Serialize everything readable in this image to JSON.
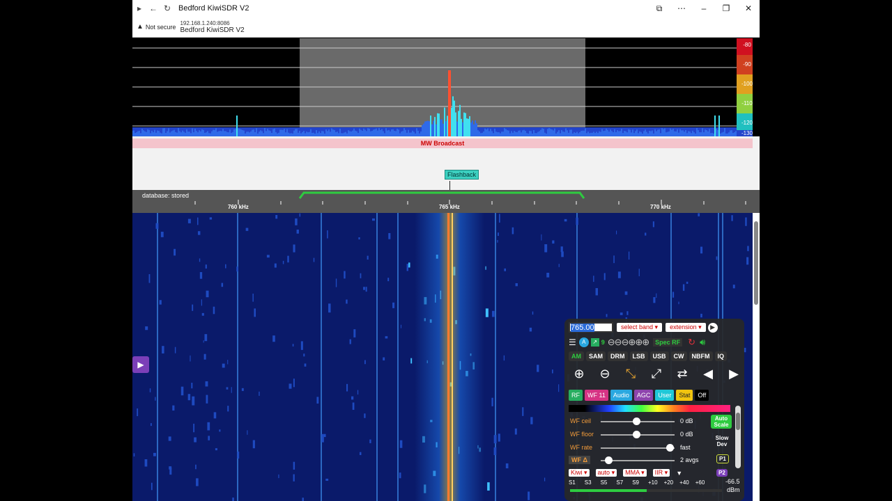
{
  "browser": {
    "title": "Bedford KiwiSDR V2",
    "security": "Not secure",
    "url": "192.168.1.240:8086",
    "page_title": "Bedford KiwiSDR V2"
  },
  "spectrum": {
    "db_labels": [
      "-80",
      "-90",
      "-100",
      "-110",
      "-120",
      "-130"
    ]
  },
  "band": {
    "label": "MW Broadcast",
    "station": "Flashback"
  },
  "scale": {
    "database": "database: stored",
    "freq_labels": [
      "760 kHz",
      "765 kHz",
      "770 kHz"
    ]
  },
  "panel": {
    "frequency": "765.00",
    "select_band": "select band",
    "extension": "extension",
    "badge_a": "A",
    "badge_9": "9",
    "spec_rf": "Spec RF",
    "modes": [
      "AM",
      "SAM",
      "DRM",
      "LSB",
      "USB",
      "CW",
      "NBFM",
      "IQ"
    ],
    "tabs": [
      "RF",
      "WF 11",
      "Audio",
      "AGC",
      "User",
      "Stat",
      "Off"
    ],
    "sliders": [
      {
        "label": "WF ceil",
        "value": "0 dB"
      },
      {
        "label": "WF floor",
        "value": "0 dB"
      },
      {
        "label": "WF rate",
        "value": "fast"
      },
      {
        "label": "WF Δ",
        "value": "2 avgs"
      }
    ],
    "auto_scale": "Auto Scale",
    "slow_dev": "Slow Dev",
    "p1": "P1",
    "p2": "P2",
    "dropdowns": [
      "Kiwi",
      "auto",
      "MMA",
      "IIR"
    ],
    "smeter_labels": [
      "S1",
      "S3",
      "S5",
      "S7",
      "S9",
      "+10",
      "+20",
      "+40",
      "+60"
    ],
    "smeter_value": "-66.5",
    "smeter_unit": "dBm"
  }
}
